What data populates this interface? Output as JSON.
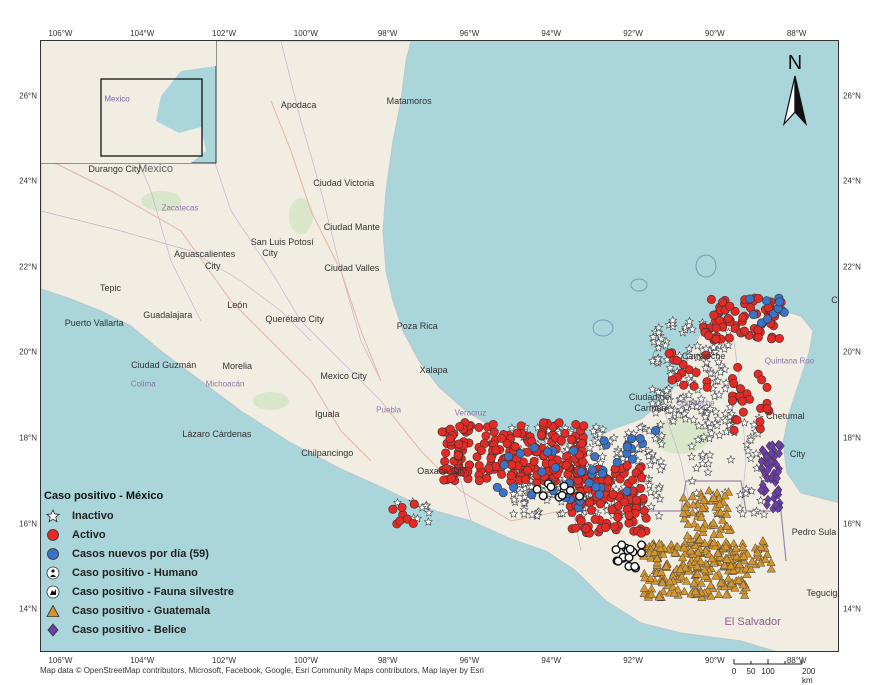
{
  "lon_ticks": [
    "106°W",
    "104°W",
    "102°W",
    "100°W",
    "98°W",
    "96°W",
    "94°W",
    "92°W",
    "90°W",
    "88°W"
  ],
  "lat_ticks": [
    "26°N",
    "24°N",
    "22°N",
    "20°N",
    "18°N",
    "16°N",
    "14°N"
  ],
  "north_label": "N",
  "inset_label": "Mexico",
  "places": [
    {
      "name": "Apodaca",
      "lon": -100.2,
      "lat": 25.8,
      "kind": "city"
    },
    {
      "name": "Matamoros",
      "lon": -97.5,
      "lat": 25.9,
      "kind": "city"
    },
    {
      "name": "Durango City",
      "lon": -104.7,
      "lat": 24.3,
      "kind": "city"
    },
    {
      "name": "Mexico",
      "lon": -103.7,
      "lat": 24.3,
      "kind": "country"
    },
    {
      "name": "Ciudad Victoria",
      "lon": -99.1,
      "lat": 23.99,
      "kind": "city"
    },
    {
      "name": "Zacatecas",
      "lon": -103.1,
      "lat": 23.4,
      "kind": "state"
    },
    {
      "name": "Ciudad Mante",
      "lon": -98.9,
      "lat": 22.95,
      "kind": "city"
    },
    {
      "name": "San Luis Potosí",
      "lon": -100.6,
      "lat": 22.6,
      "kind": "city"
    },
    {
      "name": "City",
      "lon": -100.9,
      "lat": 22.35,
      "kind": "city"
    },
    {
      "name": "Aguascalientes",
      "lon": -102.5,
      "lat": 22.33,
      "kind": "city"
    },
    {
      "name": "City",
      "lon": -102.3,
      "lat": 22.05,
      "kind": "city"
    },
    {
      "name": "Ciudad Valles",
      "lon": -98.9,
      "lat": 22.0,
      "kind": "city"
    },
    {
      "name": "Tepic",
      "lon": -104.8,
      "lat": 21.52,
      "kind": "city"
    },
    {
      "name": "León",
      "lon": -101.7,
      "lat": 21.13,
      "kind": "city"
    },
    {
      "name": "Guadalajara",
      "lon": -103.4,
      "lat": 20.9,
      "kind": "city"
    },
    {
      "name": "Querétaro City",
      "lon": -100.3,
      "lat": 20.8,
      "kind": "city"
    },
    {
      "name": "Puerto Vallarta",
      "lon": -105.2,
      "lat": 20.7,
      "kind": "city"
    },
    {
      "name": "Poza Rica",
      "lon": -97.3,
      "lat": 20.65,
      "kind": "city"
    },
    {
      "name": "Ciudad Guzmán",
      "lon": -103.5,
      "lat": 19.72,
      "kind": "city"
    },
    {
      "name": "Morelia",
      "lon": -101.7,
      "lat": 19.7,
      "kind": "city"
    },
    {
      "name": "Colima",
      "lon": -104.0,
      "lat": 19.28,
      "kind": "state"
    },
    {
      "name": "Michoacán",
      "lon": -102.0,
      "lat": 19.28,
      "kind": "state"
    },
    {
      "name": "Mexico City",
      "lon": -99.1,
      "lat": 19.47,
      "kind": "city"
    },
    {
      "name": "Xalapa",
      "lon": -96.9,
      "lat": 19.62,
      "kind": "city"
    },
    {
      "name": "Puebla",
      "lon": -98.0,
      "lat": 18.68,
      "kind": "state"
    },
    {
      "name": "Iguala",
      "lon": -99.5,
      "lat": 18.58,
      "kind": "city"
    },
    {
      "name": "Veracruz",
      "lon": -96.0,
      "lat": 18.62,
      "kind": "state"
    },
    {
      "name": "Lázaro Cárdenas",
      "lon": -102.2,
      "lat": 18.12,
      "kind": "city"
    },
    {
      "name": "Chilpancingo",
      "lon": -99.5,
      "lat": 17.67,
      "kind": "city"
    },
    {
      "name": "Oaxaca City",
      "lon": -96.7,
      "lat": 17.25,
      "kind": "city"
    },
    {
      "name": "Campeche",
      "lon": -90.3,
      "lat": 19.95,
      "kind": "city"
    },
    {
      "name": "Ciudad del",
      "lon": -91.6,
      "lat": 18.98,
      "kind": "city"
    },
    {
      "name": "Carmen",
      "lon": -91.6,
      "lat": 18.73,
      "kind": "city"
    },
    {
      "name": "Campeche",
      "lon": -90.5,
      "lat": 18.85,
      "kind": "state"
    },
    {
      "name": "Chetumal",
      "lon": -88.3,
      "lat": 18.53,
      "kind": "city"
    },
    {
      "name": "Quintana Roo",
      "lon": -88.2,
      "lat": 19.82,
      "kind": "state"
    },
    {
      "name": "Cancún",
      "lon": -86.8,
      "lat": 21.25,
      "kind": "city"
    },
    {
      "name": "City",
      "lon": -88.0,
      "lat": 17.65,
      "kind": "city"
    },
    {
      "name": "Pedro Sula",
      "lon": -87.6,
      "lat": 15.82,
      "kind": "city"
    },
    {
      "name": "Tegucigalpa",
      "lon": -87.2,
      "lat": 14.4,
      "kind": "city"
    },
    {
      "name": "El Salvador",
      "lon": -89.1,
      "lat": 13.73,
      "kind": "country2"
    }
  ],
  "legend": {
    "title": "Caso positivo - México",
    "items": [
      {
        "label": "Inactivo",
        "symbol": "star-icon"
      },
      {
        "label": "Activo",
        "symbol": "red-circle-icon",
        "color": "#e32a24"
      },
      {
        "label": "Casos nuevos por día (59)",
        "symbol": "blue-circle-icon",
        "color": "#3a73c6"
      },
      {
        "label": "Caso positivo - Humano",
        "symbol": "human-icon"
      },
      {
        "label": "Caso positivo - Fauna silvestre",
        "symbol": "fauna-icon"
      },
      {
        "label": "Caso positivo - Guatemala",
        "symbol": "orange-triangle-icon",
        "color": "#d4952c"
      },
      {
        "label": "Caso positivo - Belice",
        "symbol": "purple-diamond-icon",
        "color": "#6b3fa8"
      }
    ]
  },
  "attribution": "Map data © OpenStreetMap contributors, Microsoft, Facebook, Google, Esri Community Maps contributors, Map layer by Esri",
  "scale_bar": {
    "labels": [
      "0",
      "50",
      "100",
      "200 km"
    ]
  },
  "colors": {
    "ocean": "#a9d5db",
    "land": "#f1ede3",
    "active": "#e32a24",
    "new": "#3a73c6",
    "guatemala": "#d4952c",
    "belize": "#6b3fa8"
  }
}
